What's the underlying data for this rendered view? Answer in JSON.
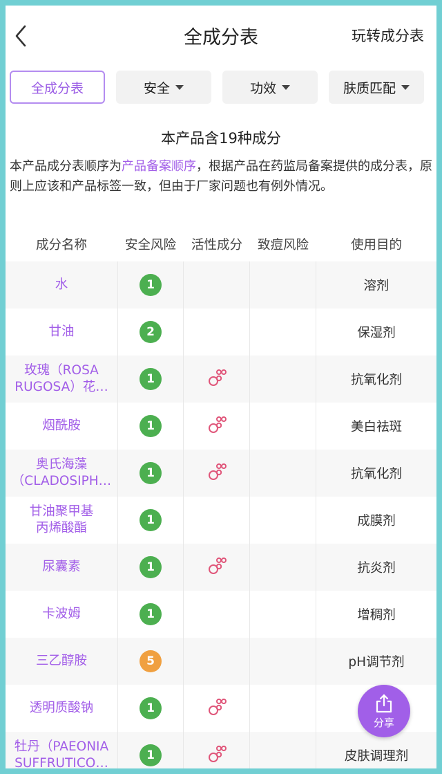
{
  "navbar": {
    "title": "全成分表",
    "right_link": "玩转成分表"
  },
  "filters": [
    {
      "label": "全成分表",
      "active": true
    },
    {
      "label": "安全",
      "active": false
    },
    {
      "label": "功效",
      "active": false
    },
    {
      "label": "肤质匹配",
      "active": false
    }
  ],
  "summary": "本产品含19种成分",
  "description": {
    "prefix": "本产品成分表顺序为",
    "link": "产品备案顺序",
    "suffix": "，根据产品在药监局备案提供的成分表，原则上应该和产品标签一致，但由于厂家问题也有例外情况。"
  },
  "table": {
    "headers": [
      "成分名称",
      "安全风险",
      "活性成分",
      "致痘风险",
      "使用目的"
    ],
    "rows": [
      {
        "name": "水",
        "risk": "1",
        "active": false,
        "purpose": "溶剂"
      },
      {
        "name": "甘油",
        "risk": "2",
        "active": false,
        "purpose": "保湿剂"
      },
      {
        "name": "玫瑰（ROSA\nRUGOSA）花…",
        "risk": "1",
        "active": true,
        "purpose": "抗氧化剂"
      },
      {
        "name": "烟酰胺",
        "risk": "1",
        "active": true,
        "purpose": "美白祛斑"
      },
      {
        "name": "奥氏海藻\n（CLADOSIPH…",
        "risk": "1",
        "active": true,
        "purpose": "抗氧化剂"
      },
      {
        "name": "甘油聚甲基\n丙烯酸酯",
        "risk": "1",
        "active": false,
        "purpose": "成膜剂"
      },
      {
        "name": "尿囊素",
        "risk": "1",
        "active": true,
        "purpose": "抗炎剂"
      },
      {
        "name": "卡波姆",
        "risk": "1",
        "active": false,
        "purpose": "增稠剂"
      },
      {
        "name": "三乙醇胺",
        "risk": "5",
        "active": false,
        "purpose": "pH调节剂"
      },
      {
        "name": "透明质酸钠",
        "risk": "1",
        "active": true,
        "purpose": ""
      },
      {
        "name": "牡丹（PAEONIA\nSUFFRUTICO…",
        "risk": "1",
        "active": true,
        "purpose": "皮肤调理剂"
      }
    ]
  },
  "share": {
    "label": "分享"
  },
  "colors": {
    "accent": "#a25ee8",
    "risk_low": "#4caf50",
    "risk_mid": "#f0a040",
    "active_icon": "#e0567a",
    "frame_border": "#71cfd3"
  },
  "icons": {
    "back": "chevron-left-icon",
    "active": "bubbles-icon",
    "share": "share-icon"
  }
}
